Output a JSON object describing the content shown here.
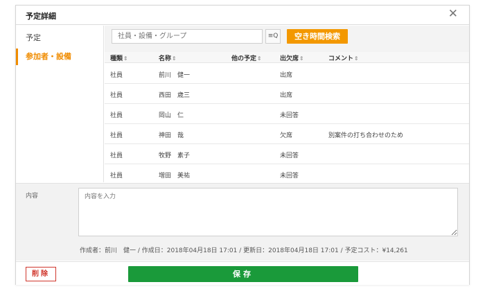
{
  "dialog": {
    "title": "予定詳細",
    "close_glyph": "✕"
  },
  "sidebar": {
    "items": [
      {
        "label": "予定",
        "active": false
      },
      {
        "label": "参加者・設備",
        "active": true
      }
    ]
  },
  "toolbar": {
    "search_placeholder": "社員・設備・グループ",
    "search_icon": "search-icon",
    "search_glyph": "≡Q",
    "free_time_label": "空き時間検索"
  },
  "table": {
    "sort_glyph": "⇕",
    "headers": {
      "type": "種類",
      "name": "名称",
      "other": "他の予定",
      "attendance": "出欠席",
      "comment": "コメント"
    },
    "rows": [
      {
        "type": "社員",
        "name": "前川　健一",
        "other": "",
        "attendance": "出席",
        "comment": ""
      },
      {
        "type": "社員",
        "name": "西田　歳三",
        "other": "",
        "attendance": "出席",
        "comment": ""
      },
      {
        "type": "社員",
        "name": "岡山　仁",
        "other": "",
        "attendance": "未回答",
        "comment": ""
      },
      {
        "type": "社員",
        "name": "神田　哉",
        "other": "",
        "attendance": "欠席",
        "comment": "別案件の打ち合わせのため"
      },
      {
        "type": "社員",
        "name": "牧野　素子",
        "other": "",
        "attendance": "未回答",
        "comment": ""
      },
      {
        "type": "社員",
        "name": "増田　美祐",
        "other": "",
        "attendance": "未回答",
        "comment": ""
      }
    ]
  },
  "content": {
    "label": "内容",
    "placeholder": "内容を入力",
    "meta": "作成者：前川　健一 / 作成日：2018年04月18日 17:01 / 更新日：2018年04月18日 17:01 / 予定コスト：¥14,261"
  },
  "footer": {
    "delete_label": "削除",
    "save_label": "保存"
  },
  "colors": {
    "accent": "#f39800",
    "save": "#1a9a3a",
    "delete": "#d0352b"
  }
}
